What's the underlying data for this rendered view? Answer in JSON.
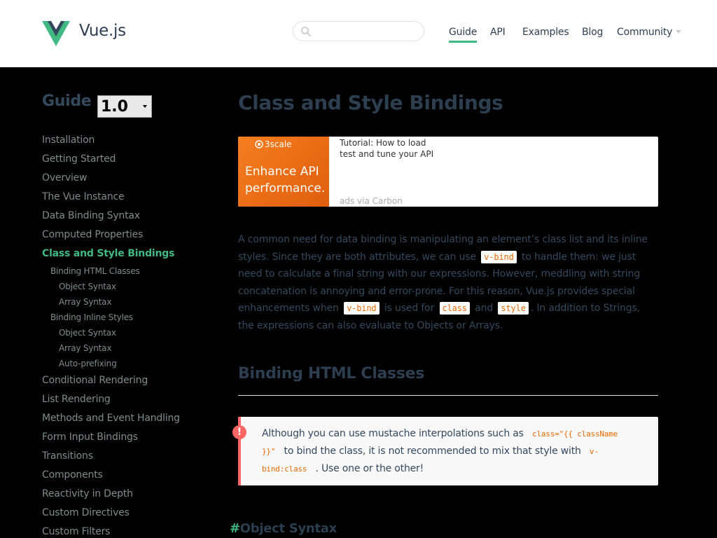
{
  "header": {
    "brand": "Vue.js",
    "search_placeholder": "",
    "nav": [
      {
        "label": "Guide",
        "active": true
      },
      {
        "label": "API"
      },
      {
        "label": "Examples"
      },
      {
        "label": "Blog"
      },
      {
        "label": "Community"
      }
    ]
  },
  "sidebar": {
    "title": "Guide",
    "version": "1.0",
    "items": [
      {
        "label": "Installation"
      },
      {
        "label": "Getting Started"
      },
      {
        "label": "Overview"
      },
      {
        "label": "The Vue Instance"
      },
      {
        "label": "Data Binding Syntax"
      },
      {
        "label": "Computed Properties"
      },
      {
        "label": "Class and Style Bindings"
      },
      {
        "label": "Binding HTML Classes"
      },
      {
        "label": "Object Syntax"
      },
      {
        "label": "Array Syntax"
      },
      {
        "label": "Binding Inline Styles"
      },
      {
        "label": "Object Syntax"
      },
      {
        "label": "Array Syntax"
      },
      {
        "label": "Auto-prefixing"
      },
      {
        "label": "Conditional Rendering"
      },
      {
        "label": "List Rendering"
      },
      {
        "label": "Methods and Event Handling"
      },
      {
        "label": "Form Input Bindings"
      },
      {
        "label": "Transitions"
      },
      {
        "label": "Components"
      },
      {
        "label": "Reactivity in Depth"
      },
      {
        "label": "Custom Directives"
      },
      {
        "label": "Custom Filters"
      }
    ]
  },
  "main": {
    "title": "Class and Style Bindings",
    "ad": {
      "brand": "3scale",
      "headline": "Enhance API performance.",
      "text": "Tutorial: How to load test and tune your API",
      "via": "ads via Carbon"
    },
    "intro": {
      "p1": "A common need for data binding is manipulating an element’s class list and its inline styles. Since they are both attributes, we can use",
      "code1": "v-bind",
      "p2": "to handle them: we just need to calculate a final string with our expressions. However, meddling with string concatenation is annoying and error-prone. For this reason, Vue.js provides special enhancements when",
      "code2": "v-bind",
      "p3": "is used for",
      "code3": "class",
      "p4": "and",
      "code4": "style",
      "p5": ". In addition to Strings, the expressions can also evaluate to Objects or Arrays."
    },
    "section_title": "Binding HTML Classes",
    "tip": {
      "icon": "!",
      "t1": "Although you can use mustache interpolations such as",
      "code1": "class=\"{{ className }}\"",
      "t2": "to bind the class, it is not recommended to mix that style with",
      "code2": "v-bind:class",
      "t3": ". Use one or the other!"
    },
    "subsection": {
      "hash": "#",
      "title": "Object Syntax"
    }
  },
  "colors": {
    "accent": "#42b983",
    "text": "#2c3e50",
    "code": "#e96900",
    "warning": "#ff6666"
  }
}
